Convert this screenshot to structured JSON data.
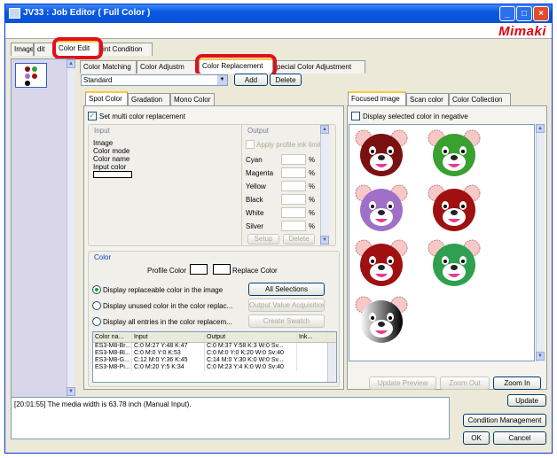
{
  "window": {
    "title": "JV33 : Job Editor ( Full Color )",
    "brand": "Mimaki"
  },
  "main_tabs": [
    "Image",
    "dit",
    "Color Edit",
    "int Condition"
  ],
  "sub_tabs": [
    "Color Matching",
    "Color Adjustm",
    "Color Replacement",
    "pecial Color Adjustment"
  ],
  "preset": {
    "value": "Standard",
    "add": "Add",
    "delete": "Delete"
  },
  "spot_tabs": [
    "Spot Color",
    "Gradation",
    "Mono Color"
  ],
  "multi_replace": "Set multi color replacement",
  "input": {
    "title": "Input",
    "image": "Image",
    "mode": "Color mode",
    "name": "Color name",
    "color": "Input color"
  },
  "output": {
    "title": "Output",
    "apply": "Apply profile ink limit",
    "inks": [
      "Cyan",
      "Magenta",
      "Yellow",
      "Black",
      "White",
      "Silver"
    ],
    "unit": "%",
    "setup": "Setup",
    "delete": "Delete"
  },
  "color": {
    "title": "Color",
    "profile": "Profile Color",
    "replace": "Replace Color",
    "opt1": "Display replaceable color in the image",
    "opt2": "Display unused color in the color replac...",
    "opt3": "Display all entries in the color replacem...",
    "all_sel": "All Selections",
    "out_acq": "Output Value Acquisition",
    "swatch": "Create Swatch"
  },
  "table": {
    "headers": [
      "Color na...",
      "Input",
      "Output",
      "Ink..."
    ],
    "rows": [
      [
        "ES3-M8-Br...",
        "C:0 M:27 Y:48 K:47",
        "C:0 M:37 Y:58 K:3 W:0 Sv..."
      ],
      [
        "ES3-M8-Bl...",
        "C:0 M:0 Y:0 K:53",
        "C:0 M:0 Y:0 K:20 W:0 Sv:40"
      ],
      [
        "ES3-M8-G...",
        "C:12 M:0 Y:36 K:45",
        "C:14 M:0 Y:30 K:0 W:0 Sv..."
      ],
      [
        "ES3-M8-Pi...",
        "C:0 M:20 Y:5 K:34",
        "C:0 M:23 Y:4 K:0 W:0 Sv:40"
      ]
    ]
  },
  "right_tabs": [
    "Focused image",
    "Scan color",
    "Color Collection"
  ],
  "negative": "Display selected color in negative",
  "right_buttons": {
    "preview": "Update Preview",
    "zoom_out": "Zoom Out",
    "zoom_in": "Zoom In"
  },
  "update": "Update",
  "log": "[20:01:55] The media width is 63.78 inch (Manual Input).",
  "footer": {
    "condition": "Condition Management",
    "ok": "OK",
    "cancel": "Cancel"
  },
  "bears": [
    {
      "color": "#7a1010"
    },
    {
      "color": "#3aa030"
    },
    {
      "color": "#a070c8"
    },
    {
      "color": "#a01010"
    },
    {
      "color": "#a01010"
    },
    {
      "color": "#2ea050"
    },
    {
      "color": "#000000",
      "mono": true
    }
  ]
}
